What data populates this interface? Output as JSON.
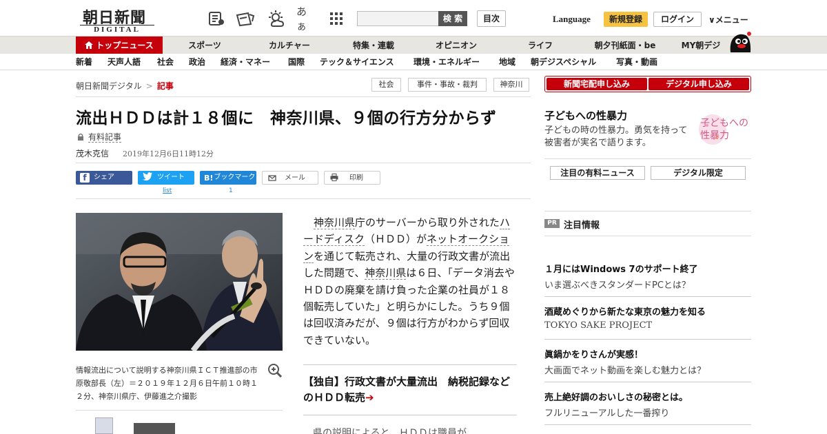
{
  "header": {
    "logo_main": "朝日新聞",
    "logo_sub": "DIGITAL",
    "search_button": "検 索",
    "search_placeholder": "",
    "toc_button": "目次",
    "language": "Language",
    "register": "新規登録",
    "login": "ログイン",
    "menu": "∨メニュー",
    "font_size_icon_text": "あぁ"
  },
  "nav_main": [
    "トップニュース",
    "スポーツ",
    "カルチャー",
    "特集・連載",
    "オピニオン",
    "ライフ",
    "朝夕刊紙面・be",
    "MY朝デジ"
  ],
  "nav_sub": [
    "新着",
    "天声人語",
    "社会",
    "政治",
    "経済・マネー",
    "国際",
    "テック＆サイエンス",
    "環境・エネルギー",
    "地域",
    "朝デジスペシャル",
    "写真・動画"
  ],
  "breadcrumb": {
    "root": "朝日新聞デジタル",
    "sep": ">",
    "current": "記事"
  },
  "tags": [
    "社会",
    "事件・事故・裁判",
    "神奈川"
  ],
  "article": {
    "headline": "流出ＨＤＤは計１８個に　神奈川県、９個の行方分からず",
    "paid_label": "有料記事",
    "author": "茂木克信",
    "date": "2019年12月6日11時12分",
    "body_parts": {
      "l1": "神奈川県",
      "t1": "庁のサーバーから取り外された",
      "l2": "ハードディスク",
      "t2": "（ＨＤＤ）が",
      "l3": "ネットオークション",
      "t3": "を通じて転売され、大量の行政文書が流出した問題で、",
      "l4": "神奈川県",
      "t4": "は６日、「データ消去やＨＤＤの廃棄を請け負った企業の社員が１８個転売していた」と明らかにした。うち９個は回収済みだが、９個は行方がわからず回収できていない。"
    },
    "photo_caption": "情報流出について説明する神奈川県ＩＣＴ推進部の市原敬部長（左）＝２０１９年１２月６日午前１０時１２分、神奈川県庁、伊藤進之介撮影",
    "related_link": "【独自】行政文書が大量流出　納税記録などのＨＤＤ転売",
    "related_arrow": "➔",
    "peek_text": "　県の説明によると、ＨＤＤは職員が"
  },
  "share": {
    "facebook": "シェア",
    "twitter": "ツイート",
    "twitter_count": "list",
    "hatena": "ブックマーク",
    "hatena_count": "1",
    "mail": "メール",
    "print": "印刷"
  },
  "sidebar": {
    "subscribe_paper": "新聞宅配申し込み",
    "subscribe_digital": "デジタル申し込み",
    "feature_title": "子どもへの性暴力",
    "feature_desc": "子どもの時の性暴力。勇気を持って被害者が実名で語ります。",
    "feature_logo": "子どもへの性暴力",
    "tab_paid": "注目の有料ニュース",
    "tab_digital": "デジタル限定",
    "pr_badge": "PR",
    "pr_label": "注目情報",
    "pr_items": [
      {
        "title": "１月にはWindows 7のサポート終了",
        "sub": "いま選ぶべきスタンダードPCとは？"
      },
      {
        "title": "酒蔵めぐりから新たな東京の魅力を知る",
        "sub": "TOKYO SAKE PROJECT"
      },
      {
        "title": "眞鍋かをりさんが実感！",
        "sub": "大画面でネット動画を楽しむ魅力とは？"
      },
      {
        "title": "売上絶好調のおいしさの秘密とは。",
        "sub": "フルリニューアルした一番搾り"
      }
    ]
  },
  "colors": {
    "brand_red": "#c6000b",
    "register_yellow": "#f5c242",
    "facebook": "#3b5998",
    "twitter": "#1da1f2",
    "hatena": "#1f86d8"
  }
}
